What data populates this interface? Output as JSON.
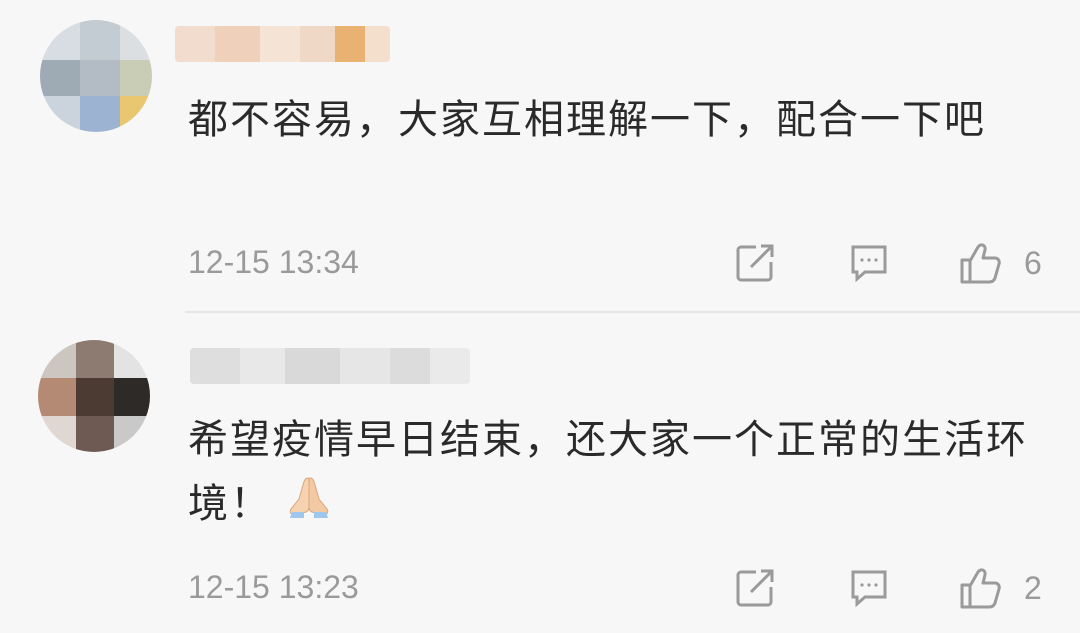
{
  "comments": [
    {
      "text": "都不容易，大家互相理解一下，配合一下吧",
      "time": "12-15 13:34",
      "likes": "6"
    },
    {
      "text": "希望疫情早日结束，还大家一个正常的生活环境！",
      "time": "12-15 13:23",
      "likes": "2",
      "emoji": "folded-hands"
    }
  ],
  "icons": {
    "share": "share-icon",
    "reply": "comment-icon",
    "like": "thumbs-up-icon"
  },
  "colors": {
    "background": "#f7f7f7",
    "text": "#2a2a2a",
    "meta": "#9a9a9a",
    "divider": "#e6e6e6"
  }
}
